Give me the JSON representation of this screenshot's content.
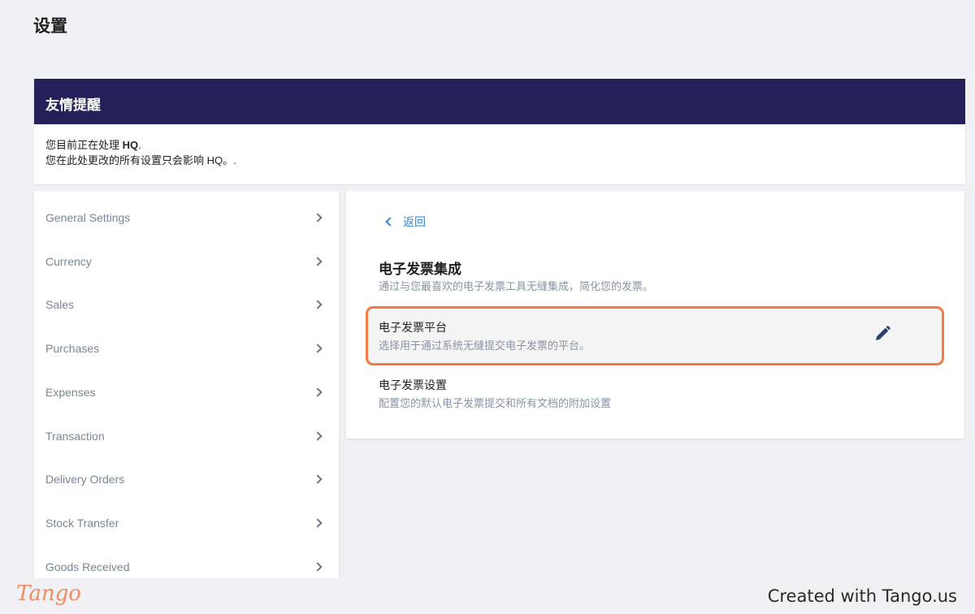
{
  "page_title": "设置",
  "notice": {
    "title": "友情提醒",
    "line1_prefix": "您目前正在处理 ",
    "line1_bold": "HQ",
    "line1_suffix": ".",
    "line2": "您在此处更改的所有设置只会影响 HQ。."
  },
  "sidebar": {
    "items": [
      {
        "label": "General Settings"
      },
      {
        "label": "Currency"
      },
      {
        "label": "Sales"
      },
      {
        "label": "Purchases"
      },
      {
        "label": "Expenses"
      },
      {
        "label": "Transaction"
      },
      {
        "label": "Delivery Orders"
      },
      {
        "label": "Stock Transfer"
      },
      {
        "label": "Goods Received"
      }
    ]
  },
  "main": {
    "back_label": "返回",
    "section_title": "电子发票集成",
    "section_subtitle": "通过与您最喜欢的电子发票工具无缝集成，简化您的发票。",
    "options": [
      {
        "title": "电子发票平台",
        "subtitle": "选择用于通过系统无缝提交电子发票的平台。"
      },
      {
        "title": "电子发票设置",
        "subtitle": "配置您的默认电子发票提交和所有文档的附加设置"
      }
    ]
  },
  "footer": {
    "logo_text": "Tango",
    "created_text": "Created with Tango.us"
  },
  "colors": {
    "header_bg": "#23205a",
    "highlight": "#f47a45",
    "link": "#2e86de",
    "edit_icon": "#2b3f75"
  }
}
